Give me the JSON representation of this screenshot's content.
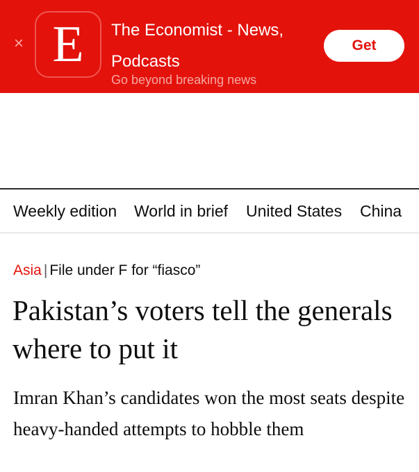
{
  "banner": {
    "close_glyph": "×",
    "app_icon_letter": "E",
    "app_title": "The Economist - News, Podcasts",
    "app_subtitle": "Go beyond breaking news",
    "get_label": "Get",
    "brand_color": "#e3120b"
  },
  "nav": {
    "items": [
      {
        "label": "Weekly edition"
      },
      {
        "label": "World in brief"
      },
      {
        "label": "United States"
      },
      {
        "label": "China"
      }
    ]
  },
  "article": {
    "section": "Asia",
    "separator": "|",
    "fly_title": "File under F for “fiasco”",
    "headline": "Pakistan’s voters tell the generals where to put it",
    "standfirst": "Imran Khan’s candidates won the most seats despite heavy-handed attempts to hobble them"
  }
}
